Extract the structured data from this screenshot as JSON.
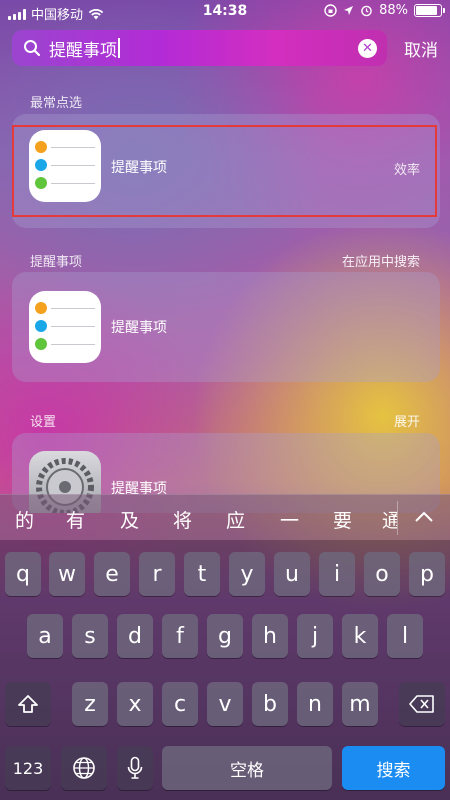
{
  "status": {
    "carrier": "中国移动",
    "time": "14:38",
    "battery_percent": "88%",
    "battery_level": 0.88
  },
  "search": {
    "query": "提醒事项",
    "cancel_label": "取消"
  },
  "top_hits": {
    "title": "最常点选",
    "item_label": "提醒事项",
    "item_tag": "效率"
  },
  "reminders_section": {
    "title": "提醒事项",
    "action": "在应用中搜索",
    "item_label": "提醒事项"
  },
  "settings_section": {
    "title": "设置",
    "action": "展开",
    "item_label": "提醒事项"
  },
  "suggestions": [
    "的",
    "有",
    "及",
    "将",
    "应",
    "一",
    "要",
    "通"
  ],
  "keyboard": {
    "row1": [
      "q",
      "w",
      "e",
      "r",
      "t",
      "y",
      "u",
      "i",
      "o",
      "p"
    ],
    "row2": [
      "a",
      "s",
      "d",
      "f",
      "g",
      "h",
      "j",
      "k",
      "l"
    ],
    "row3": [
      "z",
      "x",
      "c",
      "v",
      "b",
      "n",
      "m"
    ],
    "numbers_label": "123",
    "space_label": "空格",
    "search_label": "搜索"
  },
  "colors": {
    "highlight": "#e43a3a",
    "search_key": "#1b8cf2"
  }
}
